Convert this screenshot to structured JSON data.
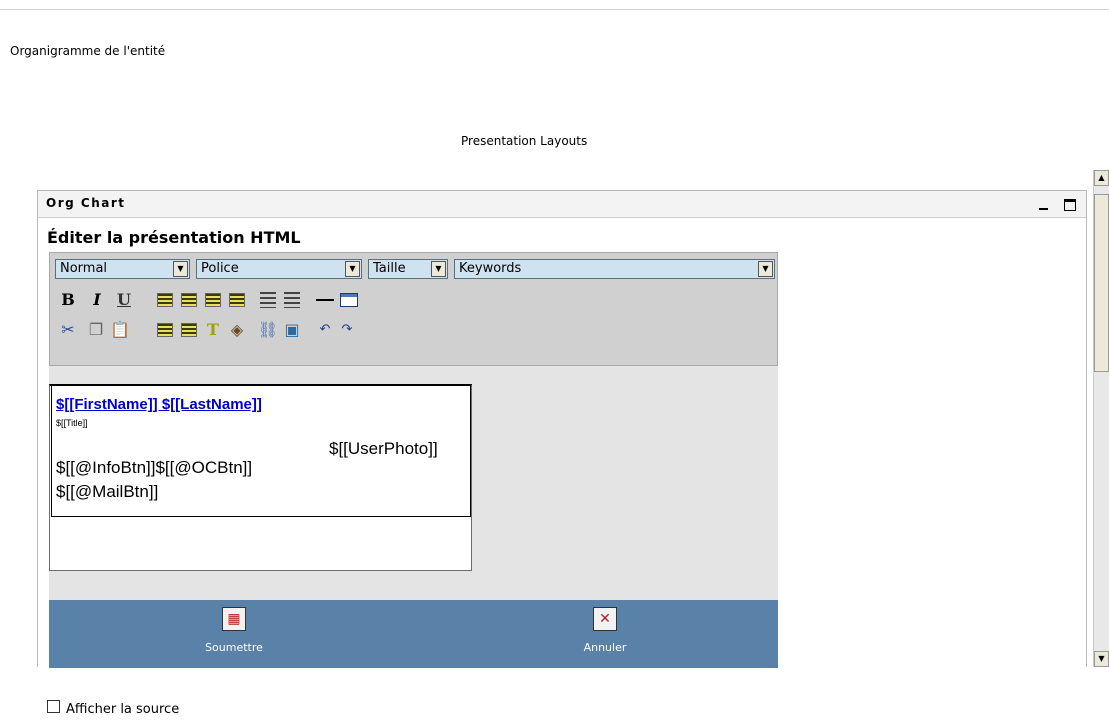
{
  "page": {
    "entity_title": "Organigramme de l'entité",
    "layouts_title": "Presentation Layouts"
  },
  "portlet": {
    "title": "Org Chart",
    "minimize_label": "_",
    "maximize_label": "",
    "heading": "Éditer la présentation HTML"
  },
  "toolbar": {
    "selects": {
      "format": "Normal",
      "font": "Police",
      "size": "Taille",
      "keywords": "Keywords"
    },
    "buttons_row1": [
      "bold-icon",
      "italic-icon",
      "underline-icon",
      "align-left-icon",
      "align-center-icon",
      "align-right-icon",
      "justify-icon",
      "ordered-list-icon",
      "unordered-list-icon",
      "horizontal-rule-icon",
      "table-icon"
    ],
    "buttons_row2": [
      "cut-icon",
      "copy-icon",
      "paste-icon",
      "outdent-icon",
      "indent-icon",
      "text-color-icon",
      "background-color-icon",
      "link-icon",
      "image-icon",
      "undo-icon",
      "redo-icon"
    ],
    "labels": {
      "bold": "B",
      "italic": "I",
      "underline": "U"
    }
  },
  "content": {
    "name": "$[[FirstName]] $[[LastName]]",
    "title": "$[[Title]]",
    "photo": "$[[UserPhoto]]",
    "buttons_line1": "$[[@InfoBtn]]$[[@OCBtn]]",
    "buttons_line2": "$[[@MailBtn]]"
  },
  "options": {
    "show_source_label": "Afficher la source",
    "show_source_checked": false
  },
  "actions": {
    "submit": "Soumettre",
    "cancel": "Annuler"
  },
  "colors": {
    "action_bar": "#5a81a8",
    "select_bg": "#cfe2ef",
    "link": "#0000cc"
  }
}
